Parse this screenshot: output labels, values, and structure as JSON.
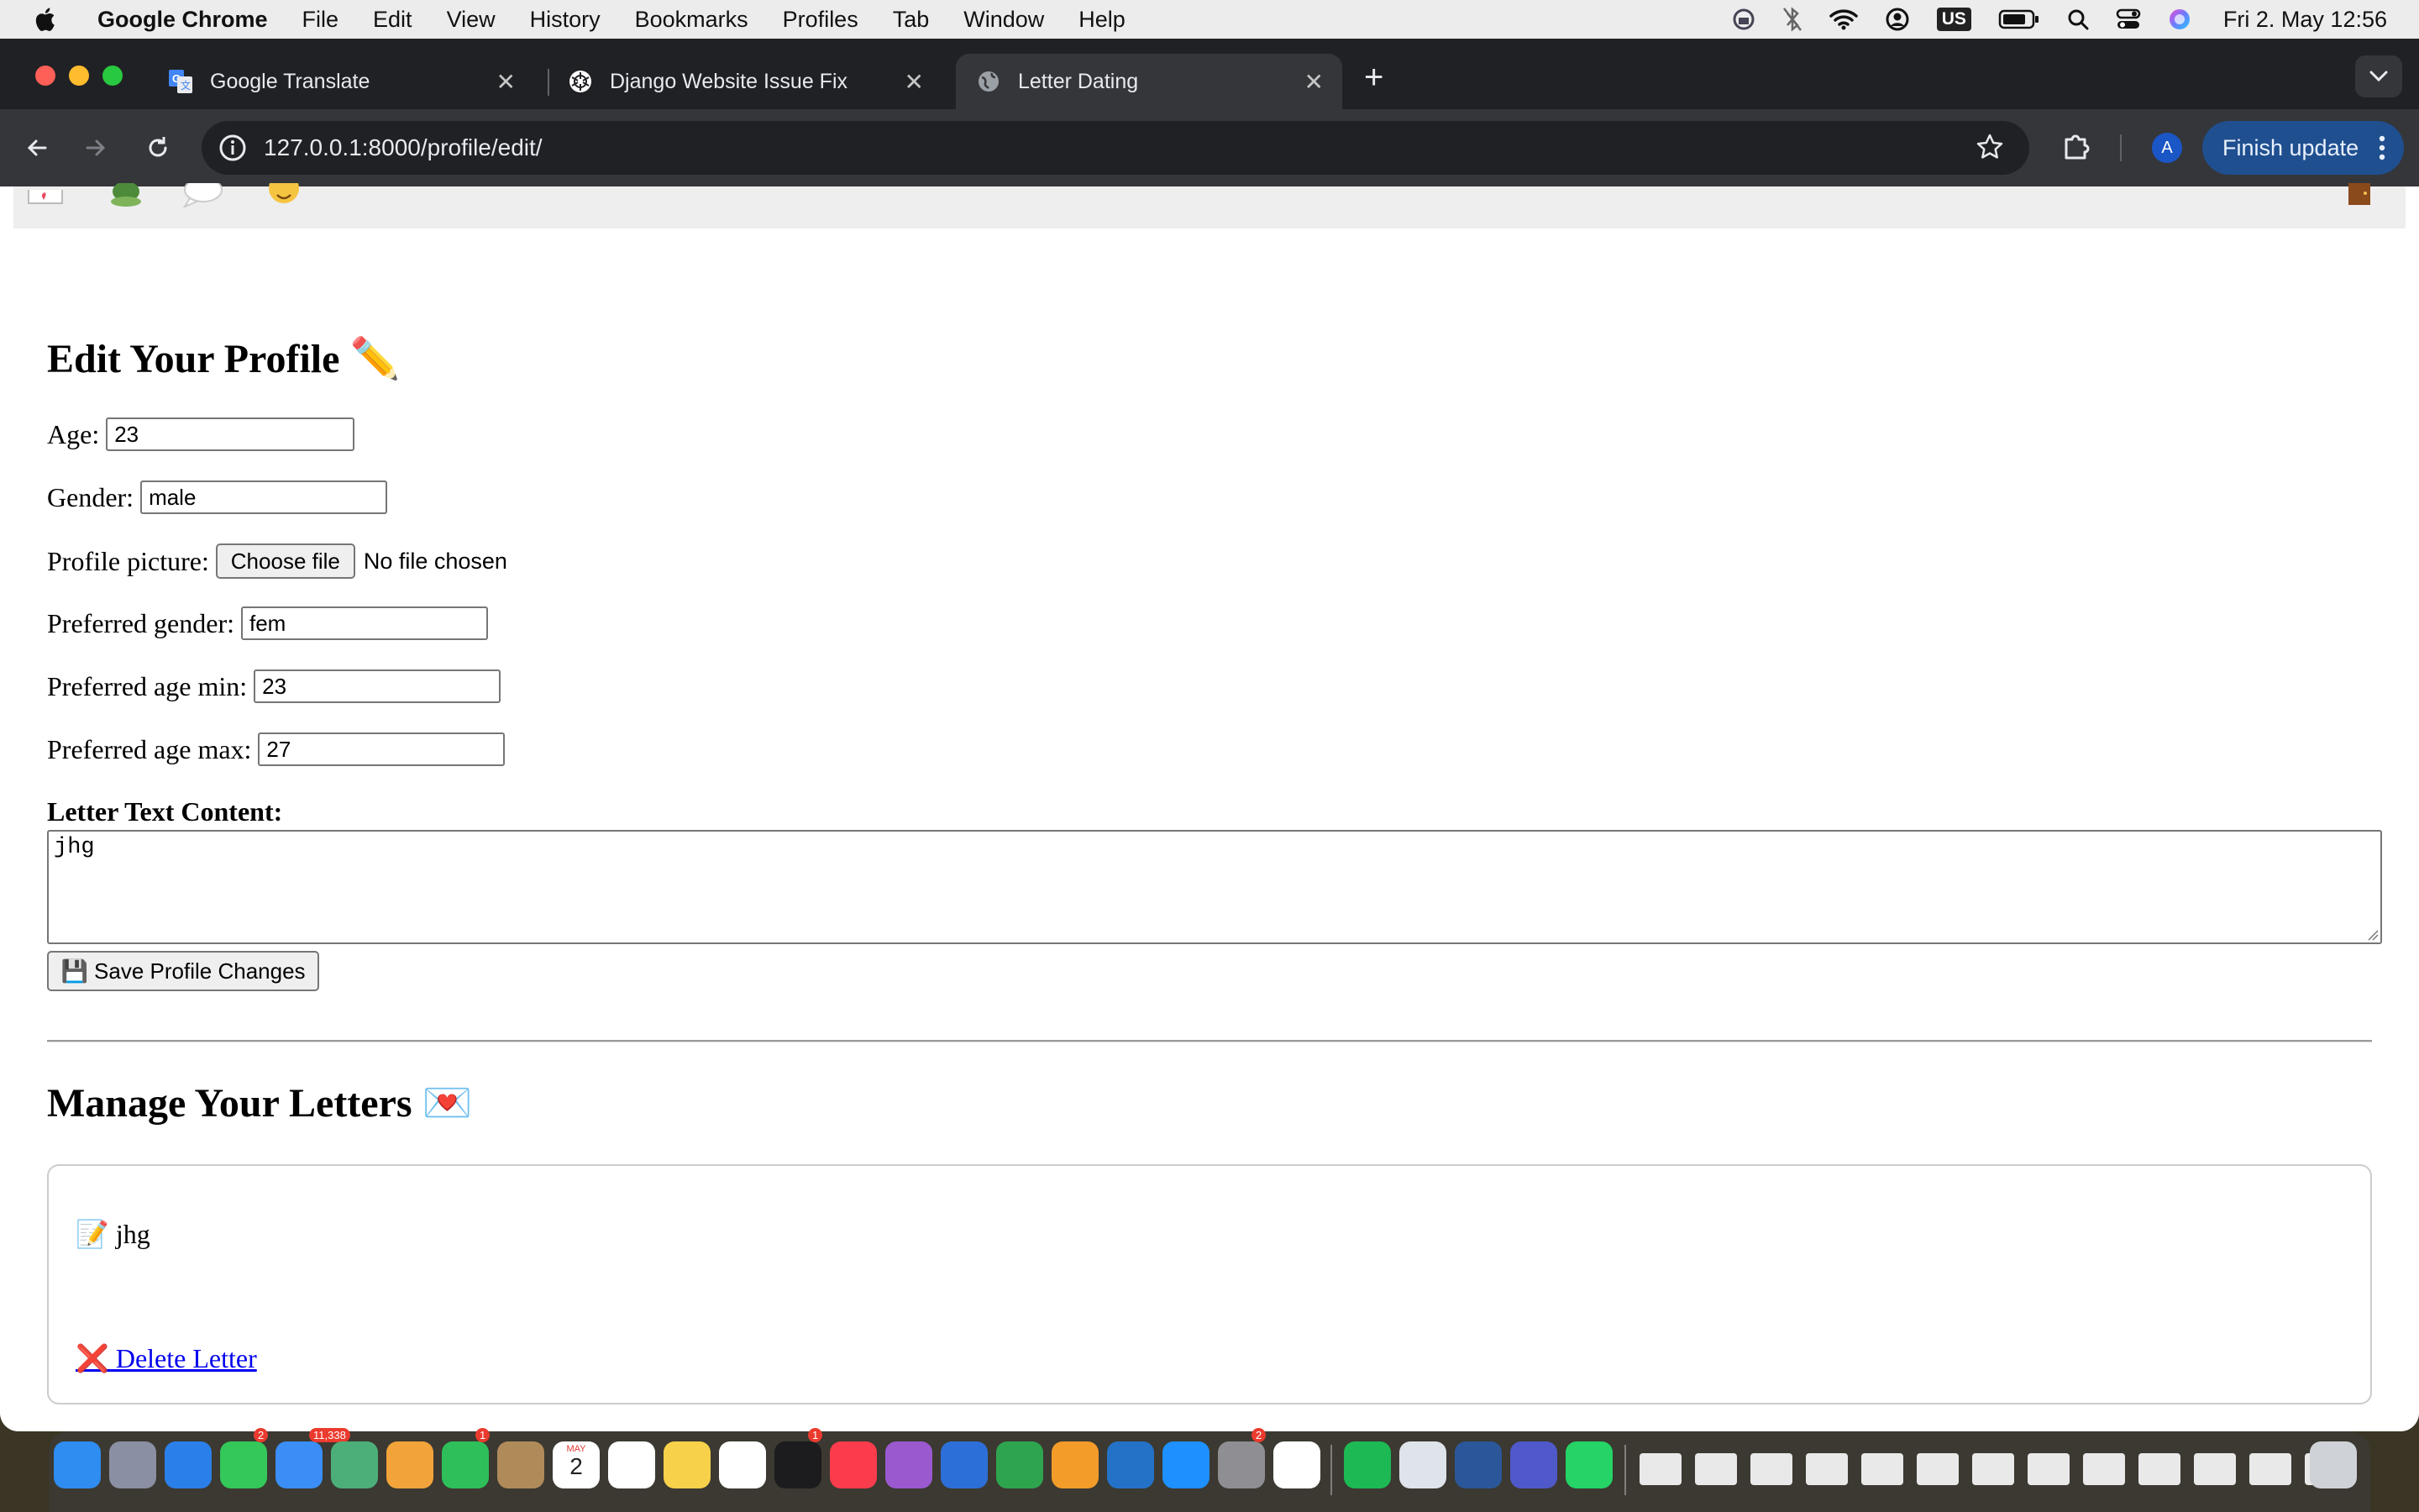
{
  "menubar": {
    "app_name": "Google Chrome",
    "items": [
      "File",
      "Edit",
      "View",
      "History",
      "Bookmarks",
      "Profiles",
      "Tab",
      "Window",
      "Help"
    ],
    "input_source": "US",
    "clock": "Fri 2. May  12:56"
  },
  "browser": {
    "tabs": [
      {
        "title": "Google Translate",
        "icon": "google-translate-icon"
      },
      {
        "title": "Django Website Issue Fix",
        "icon": "chatgpt-icon"
      },
      {
        "title": "Letter Dating",
        "icon": "globe-icon"
      }
    ],
    "active_tab": 2,
    "url": "127.0.0.1:8000/profile/edit/",
    "profile_initial": "A",
    "finish_update_label": "Finish update"
  },
  "page": {
    "nav_icons": [
      "letter-icon",
      "turtle-icon",
      "speech-bubble-icon",
      "face-icon",
      "door-icon"
    ],
    "edit_heading": "Edit Your Profile ✏️",
    "fields": {
      "age": {
        "label": "Age:",
        "value": "23"
      },
      "gender": {
        "label": "Gender:",
        "value": "male"
      },
      "profile_picture": {
        "label": "Profile picture:",
        "button": "Choose file",
        "status": "No file chosen"
      },
      "preferred_gender": {
        "label": "Preferred gender:",
        "value": "fem"
      },
      "preferred_age_min": {
        "label": "Preferred age min:",
        "value": "23"
      },
      "preferred_age_max": {
        "label": "Preferred age max:",
        "value": "27"
      }
    },
    "letter_label": "Letter Text Content:",
    "letter_value": "jhg",
    "save_button": "💾 Save Profile Changes",
    "manage_heading": "Manage Your Letters 💌",
    "letters": [
      {
        "text": "📝 jhg",
        "delete_label": "❌ Delete Letter"
      }
    ]
  },
  "dock": {
    "apps": [
      "Finder",
      "Launchpad",
      "Safari",
      "Messages",
      "Mail",
      "Maps",
      "Photos",
      "FaceTime",
      "Contacts",
      "Calendar",
      "Reminders",
      "Notes",
      "Freeform",
      "TV",
      "Music",
      "Podcasts",
      "Keynote",
      "Numbers",
      "Pages",
      "VS Code",
      "App Store",
      "System Settings",
      "Chrome",
      "Spotify",
      "Preview",
      "Word",
      "Teams",
      "WhatsApp"
    ],
    "badges": {
      "Messages": "2",
      "Mail": "11,338",
      "FaceTime": "1",
      "TV": "1",
      "System Settings": "2"
    },
    "calendar_month": "MAY",
    "calendar_day": "2"
  },
  "colors": {
    "tab_strip": "#202124",
    "toolbar": "#35363a",
    "finish_update": "#1f4f8f",
    "link": "#0000ee"
  }
}
